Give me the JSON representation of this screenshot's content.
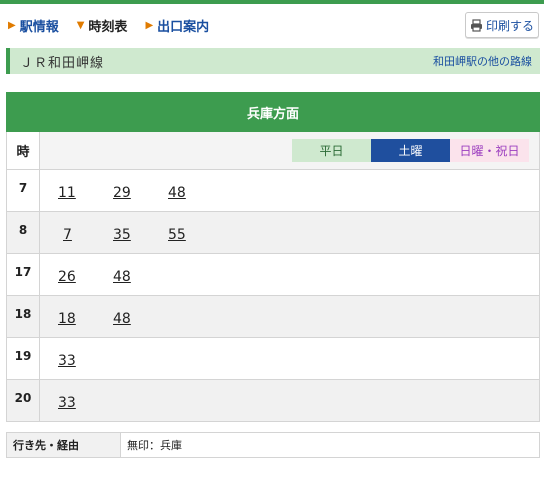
{
  "nav": {
    "items": [
      {
        "label": "駅情報",
        "marker": "▶"
      },
      {
        "label": "時刻表",
        "marker": "▼"
      },
      {
        "label": "出口案内",
        "marker": "▶"
      }
    ]
  },
  "print": {
    "label": "印刷する",
    "icon": "printer-icon"
  },
  "line": {
    "name": "ＪＲ和田岬線",
    "other_lines": "和田岬駅の他の路線"
  },
  "timetable": {
    "direction": "兵庫方面",
    "hour_header": "時",
    "day_tabs": [
      {
        "label": "平日",
        "selected": false
      },
      {
        "label": "土曜",
        "selected": true
      },
      {
        "label": "日曜・祝日",
        "selected": false
      }
    ],
    "rows": [
      {
        "hour": "7",
        "minutes": [
          "11",
          "29",
          "48"
        ]
      },
      {
        "hour": "8",
        "minutes": [
          "7",
          "35",
          "55"
        ]
      },
      {
        "hour": "17",
        "minutes": [
          "26",
          "48"
        ]
      },
      {
        "hour": "18",
        "minutes": [
          "18",
          "48"
        ]
      },
      {
        "hour": "19",
        "minutes": [
          "33"
        ]
      },
      {
        "hour": "20",
        "minutes": [
          "33"
        ]
      }
    ]
  },
  "legend": {
    "key": "行き先・経由",
    "value": "無印：兵庫"
  },
  "colors": {
    "accent": "#3d9c4f",
    "link": "#1a4fa0",
    "saturday": "#1f4f9e",
    "weekday": "#cfe9cf",
    "holiday": "#fbe3ec"
  }
}
